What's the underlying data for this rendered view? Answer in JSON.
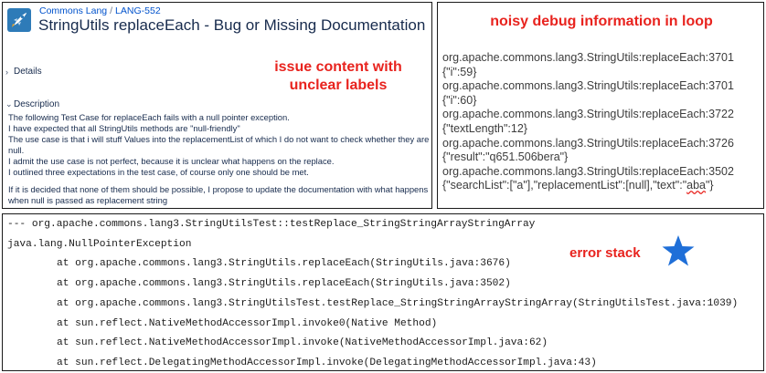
{
  "jira": {
    "breadcrumb": [
      "Commons Lang",
      "LANG-552"
    ],
    "breadcrumb_sep": "/",
    "title": "StringUtils replaceEach - Bug or Missing Documentation",
    "details_label": "Details",
    "description_label": "Description",
    "description_lines": [
      "The following Test Case for replaceEach fails with a null pointer exception.",
      "I have expected that all StringUtils methods are \"null-friendly\"",
      "The use case is that i will stuff Values into the replacementList of which I do not want to check whether they are null.",
      "I admit the use case is not perfect, because it is unclear what happens on the replace.",
      "I outlined three expectations in the test case, of course only one should be met."
    ],
    "description_footer": "If it is decided that none of them should be possible, I propose to update the documentation with what happens when null is passed as replacement string",
    "logo_colors": {
      "bg": "#2e7bb8",
      "accent": "#ffffff"
    }
  },
  "annotations": {
    "issue": [
      "issue content with",
      "unclear labels"
    ],
    "debug": "noisy debug information in loop",
    "stack": "error stack",
    "color": "#e8231e",
    "star_color": "#1f6fd8"
  },
  "debug_log": [
    "org.apache.commons.lang3.StringUtils:replaceEach:3701",
    "{\"i\":59}",
    "org.apache.commons.lang3.StringUtils:replaceEach:3701",
    "{\"i\":60}",
    "org.apache.commons.lang3.StringUtils:replaceEach:3722",
    "{\"textLength\":12}",
    "org.apache.commons.lang3.StringUtils:replaceEach:3726",
    "{\"result\":\"q651.506bera\"}",
    "org.apache.commons.lang3.StringUtils:replaceEach:3502"
  ],
  "debug_last": {
    "prefix": "{\"searchList\":[\"a\"],\"replacementList\":[null],\"text\":\"",
    "value": "aba",
    "suffix": "\"}"
  },
  "stack_trace": [
    "--- org.apache.commons.lang3.StringUtilsTest::testReplace_StringStringArrayStringArray",
    "java.lang.NullPointerException",
    "at org.apache.commons.lang3.StringUtils.replaceEach(StringUtils.java:3676)",
    "at org.apache.commons.lang3.StringUtils.replaceEach(StringUtils.java:3502)",
    "at org.apache.commons.lang3.StringUtilsTest.testReplace_StringStringArrayStringArray(StringUtilsTest.java:1039)",
    "at sun.reflect.NativeMethodAccessorImpl.invoke0(Native Method)",
    "at sun.reflect.NativeMethodAccessorImpl.invoke(NativeMethodAccessorImpl.java:62)",
    "at sun.reflect.DelegatingMethodAccessorImpl.invoke(DelegatingMethodAccessorImpl.java:43)"
  ]
}
